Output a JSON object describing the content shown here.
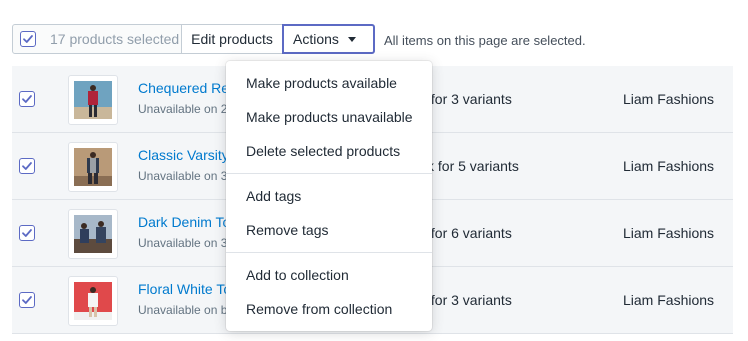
{
  "bulk_bar": {
    "selected_count_label": "17 products selected",
    "edit_label": "Edit products",
    "actions_label": "Actions",
    "note": "All items on this page are selected."
  },
  "products": [
    {
      "name": "Chequered Re",
      "status": "Unavailable on 2",
      "inventory": "k for 3 variants",
      "vendor": "Liam Fashions",
      "checked": true
    },
    {
      "name": "Classic Varsity",
      "status": "Unavailable on 3",
      "inventory": "ck for 5 variants",
      "vendor": "Liam Fashions",
      "checked": true
    },
    {
      "name": "Dark Denim To",
      "status": "Unavailable on 3",
      "inventory": "k for 6 variants",
      "vendor": "Liam Fashions",
      "checked": true
    },
    {
      "name": "Floral White To",
      "status": "Unavailable on b",
      "inventory": "k for 3 variants",
      "vendor": "Liam Fashions",
      "checked": true
    }
  ],
  "actions_menu": {
    "groups": [
      [
        "Make products available",
        "Make products unavailable",
        "Delete selected products"
      ],
      [
        "Add tags",
        "Remove tags"
      ],
      [
        "Add to collection",
        "Remove from collection"
      ]
    ]
  },
  "colors": {
    "link": "#007ace",
    "accent": "#5c6ac4",
    "row_bg": "#f4f6f8",
    "muted_text": "#919eab"
  }
}
